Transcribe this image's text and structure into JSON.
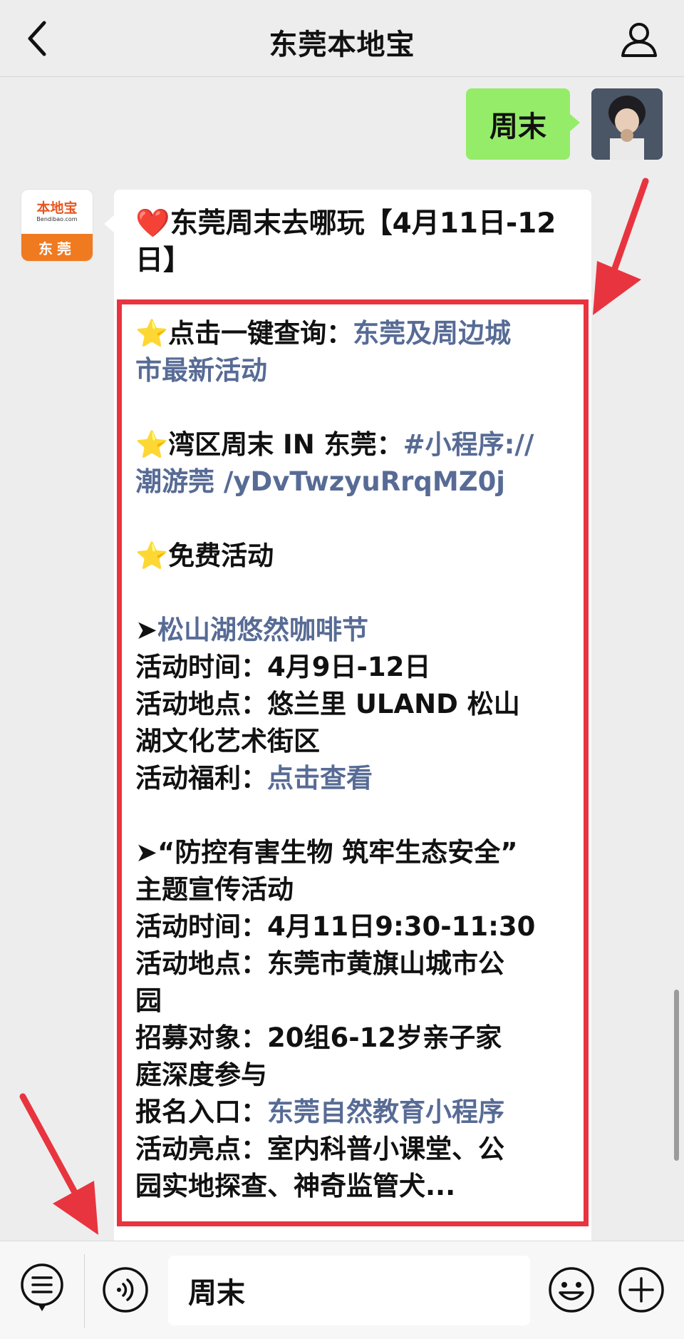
{
  "header": {
    "title": "东莞本地宝"
  },
  "chat": {
    "outgoing": {
      "text": "周末"
    },
    "incoming": {
      "avatar": {
        "logo_text": "本地宝",
        "logo_sub": "Bendibao.com",
        "city": "东莞"
      },
      "title_emoji": "❤️",
      "title": "东莞周末去哪玩【4月11日-12日】",
      "section1": {
        "emoji": "⭐",
        "label": "点击一键查询：",
        "link_part1": "东莞及周边城",
        "link_part2": "市最新活动"
      },
      "section2": {
        "emoji": "⭐",
        "label": "湾区周末 IN 东莞：",
        "link_part1": "#小程序://",
        "link_part2": "潮游莞 /yDvTwzyuRrqMZ0j"
      },
      "section3": {
        "emoji": "⭐",
        "label": "免费活动"
      },
      "event1": {
        "bullet": "➤",
        "name": "松山湖悠然咖啡节",
        "time_label": "活动时间：",
        "time": "4月9日-12日",
        "place_label": "活动地点：",
        "place_part1": "悠兰里 ULAND 松山",
        "place_part2": "湖文化艺术街区",
        "benefit_label": "活动福利：",
        "benefit_link": "点击查看"
      },
      "event2": {
        "bullet": "➤",
        "name_part1": "“防控有害生物 筑牢生态安全”",
        "name_part2": "主题宣传活动",
        "time_label": "活动时间：",
        "time": "4月11日9:30-11:30",
        "place_label": "活动地点：",
        "place_part1": "东莞市黄旗山城市公",
        "place_part2": "园",
        "target_label": "招募对象：",
        "target_part1": "20组6-12岁亲子家",
        "target_part2": "庭深度参与",
        "signup_label": "报名入口：",
        "signup_link": "东莞自然教育小程序",
        "highlight_label": "活动亮点：",
        "highlight_part1": "室内科普小课堂、公",
        "highlight_part2": "园实地探查、神奇监管犬..."
      }
    }
  },
  "input_bar": {
    "value": "周末"
  },
  "colors": {
    "background": "#ededed",
    "outgoing_bubble": "#95ec69",
    "link": "#576b95",
    "highlight_box": "#e8343f",
    "arrow": "#e8343f",
    "brand_orange": "#f07a1f"
  },
  "icons": [
    "back-icon",
    "profile-icon",
    "menu-icon",
    "voice-icon",
    "emoji-icon",
    "plus-icon"
  ]
}
